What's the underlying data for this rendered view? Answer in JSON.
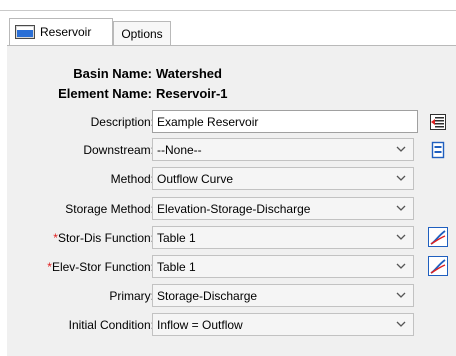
{
  "tabs": [
    {
      "label": "Reservoir",
      "icon": "reservoir-icon"
    },
    {
      "label": "Options"
    }
  ],
  "header": {
    "basin_label": "Basin Name:",
    "basin_value": "Watershed",
    "element_label": "Element Name:",
    "element_value": "Reservoir-1"
  },
  "fields": {
    "description": {
      "label": "Description:",
      "value": "Example Reservoir",
      "button_icon": "description-editor-icon"
    },
    "downstream": {
      "label": "Downstream:",
      "value": "--None--",
      "button_icon": "select-downstream-icon"
    },
    "method": {
      "label": "Method:",
      "value": "Outflow Curve"
    },
    "storage_method": {
      "label": "Storage Method:",
      "value": "Elevation-Storage-Discharge"
    },
    "stor_dis": {
      "required": "*",
      "label": "Stor-Dis Function:",
      "value": "Table 1",
      "button_icon": "chart-icon"
    },
    "elev_stor": {
      "required": "*",
      "label": "Elev-Stor Function:",
      "value": "Table 1",
      "button_icon": "chart-icon"
    },
    "primary": {
      "label": "Primary:",
      "value": "Storage-Discharge"
    },
    "initial_condition": {
      "label": "Initial Condition:",
      "value": "Inflow = Outflow"
    }
  },
  "colors": {
    "required_marker": "#e02020",
    "panel_bg": "#f0f0f0"
  }
}
